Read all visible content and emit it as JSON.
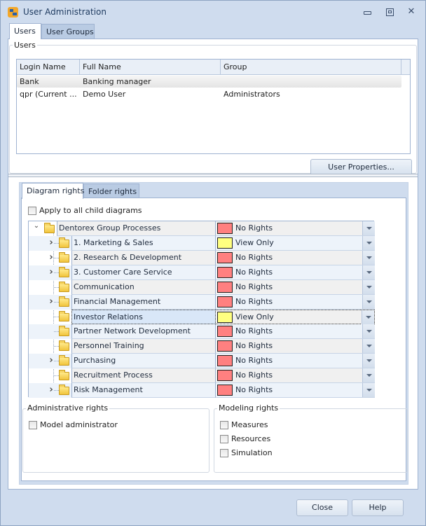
{
  "window": {
    "title": "User Administration",
    "controls": [
      "minimize",
      "maximize",
      "close"
    ]
  },
  "outer_tabs": [
    {
      "label": "Users",
      "active": true
    },
    {
      "label": "User Groups",
      "active": false
    }
  ],
  "users_section": {
    "label": "Users",
    "columns": [
      "Login Name",
      "Full Name",
      "Group"
    ],
    "rows": [
      {
        "login": "Bank",
        "full_name": "Banking manager",
        "group": "",
        "selected": true
      },
      {
        "login": "qpr (Current ...",
        "full_name": "Demo User",
        "group": "Administrators",
        "selected": false
      }
    ],
    "user_properties_button": "User Properties..."
  },
  "inner_tabs": [
    {
      "label": "Diagram rights",
      "active": true
    },
    {
      "label": "Folder rights",
      "active": false
    }
  ],
  "diagram_rights": {
    "apply_to_children_label": "Apply to all child diagrams",
    "apply_to_children_checked": false,
    "rights_colors": {
      "No Rights": "#ff8080",
      "View Only": "#ffff80"
    },
    "tree": [
      {
        "name": "Dentorex Group Processes",
        "level": 0,
        "expander": "expanded",
        "rights": "No Rights"
      },
      {
        "name": "1. Marketing & Sales",
        "level": 1,
        "expander": "collapsed",
        "rights": "View Only"
      },
      {
        "name": "2. Research & Development",
        "level": 1,
        "expander": "collapsed",
        "rights": "No Rights"
      },
      {
        "name": "3. Customer Care Service",
        "level": 1,
        "expander": "collapsed",
        "rights": "No Rights"
      },
      {
        "name": "Communication",
        "level": 1,
        "expander": "none",
        "rights": "No Rights"
      },
      {
        "name": "Financial Management",
        "level": 1,
        "expander": "collapsed",
        "rights": "No Rights"
      },
      {
        "name": "Investor Relations",
        "level": 1,
        "expander": "none",
        "rights": "View Only",
        "focused": true
      },
      {
        "name": "Partner Network Development",
        "level": 1,
        "expander": "none",
        "rights": "No Rights"
      },
      {
        "name": "Personnel Training",
        "level": 1,
        "expander": "none",
        "rights": "No Rights"
      },
      {
        "name": "Purchasing",
        "level": 1,
        "expander": "collapsed",
        "rights": "No Rights"
      },
      {
        "name": "Recruitment Process",
        "level": 1,
        "expander": "none",
        "rights": "No Rights"
      },
      {
        "name": "Risk Management",
        "level": 1,
        "expander": "collapsed",
        "rights": "No Rights"
      }
    ]
  },
  "administrative_rights": {
    "label": "Administrative rights",
    "items": [
      {
        "label": "Model administrator",
        "checked": false
      }
    ]
  },
  "modeling_rights": {
    "label": "Modeling rights",
    "items": [
      {
        "label": "Measures",
        "checked": false
      },
      {
        "label": "Resources",
        "checked": false
      },
      {
        "label": "Simulation",
        "checked": false
      }
    ]
  },
  "footer": {
    "close_button": "Close",
    "help_button": "Help"
  }
}
